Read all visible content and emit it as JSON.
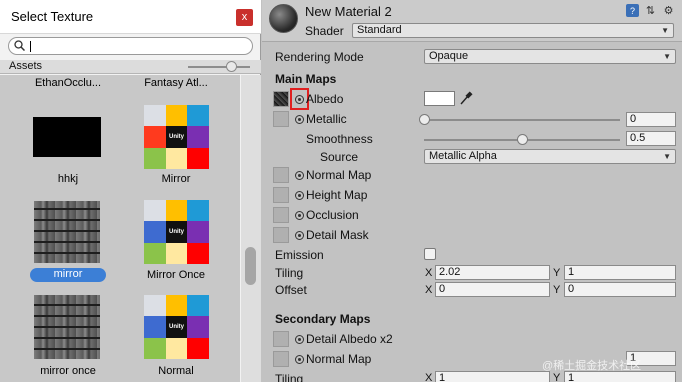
{
  "select_texture": {
    "title": "Select Texture",
    "close_glyph": "x",
    "search": {
      "value": "",
      "placeholder": ""
    },
    "tab_label": "Assets",
    "top_labels": [
      "EthanOcclu...",
      "Fantasy Atl..."
    ],
    "items": [
      {
        "label": "hhkj",
        "kind": "black"
      },
      {
        "label": "Mirror",
        "kind": "unity"
      },
      {
        "label": "mirror",
        "kind": "stone",
        "selected": true
      },
      {
        "label": "Mirror Once",
        "kind": "unity"
      },
      {
        "label": "mirror once",
        "kind": "stone"
      },
      {
        "label": "Normal",
        "kind": "unity"
      }
    ],
    "unity_logo_text": "Unity"
  },
  "inspector": {
    "material_name": "New Material 2",
    "shader_label": "Shader",
    "shader_value": "Standard",
    "rendering_mode_label": "Rendering Mode",
    "rendering_mode_value": "Opaque",
    "main_maps_label": "Main Maps",
    "albedo_label": "Albedo",
    "metallic_label": "Metallic",
    "metallic_value": "0",
    "metallic_fraction": 0.0,
    "smoothness_label": "Smoothness",
    "smoothness_value": "0.5",
    "smoothness_fraction": 0.5,
    "source_label": "Source",
    "source_value": "Metallic Alpha",
    "normal_map_label": "Normal Map",
    "height_map_label": "Height Map",
    "occlusion_label": "Occlusion",
    "detail_mask_label": "Detail Mask",
    "emission_label": "Emission",
    "tiling_label": "Tiling",
    "offset_label": "Offset",
    "axis_x": "X",
    "axis_y": "Y",
    "tiling_x": "2.02",
    "tiling_y": "1",
    "offset_x": "0",
    "offset_y": "0",
    "secondary_maps_label": "Secondary Maps",
    "detail_albedo_label": "Detail Albedo x2",
    "normal_map2_label": "Normal Map",
    "normal_map2_value": "1",
    "tiling2_label": "Tiling",
    "tiling2_x": "1",
    "tiling2_y": "1"
  },
  "watermark": "@稀土掘金技术社区",
  "colors": {
    "selection_blue": "#3c7fd6",
    "highlight_red": "#e02020",
    "close_red": "#c9302c"
  }
}
